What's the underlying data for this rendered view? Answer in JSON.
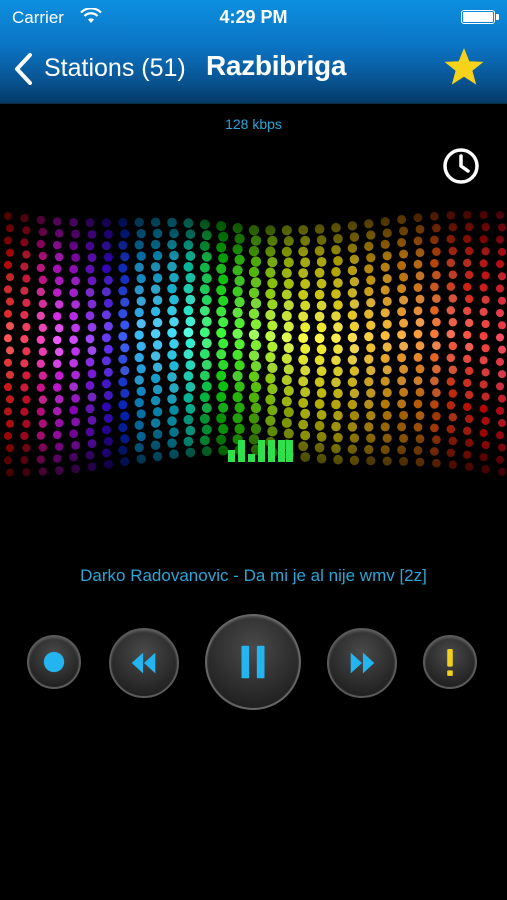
{
  "status_bar": {
    "carrier": "Carrier",
    "time": "4:29 PM"
  },
  "nav": {
    "back_label": "Stations (51)",
    "title": "Razbibriga"
  },
  "stream": {
    "bitrate": "128 kbps"
  },
  "now_playing": {
    "track": "Darko Radovanovic - Da mi je al nije wmv [2z]"
  },
  "controls": [
    "record",
    "rewind",
    "pause",
    "fast-forward",
    "alert"
  ],
  "colors": {
    "accent": "#2aa6d8",
    "nav_bar": "#0b74c4",
    "star": "#f7d21a"
  }
}
